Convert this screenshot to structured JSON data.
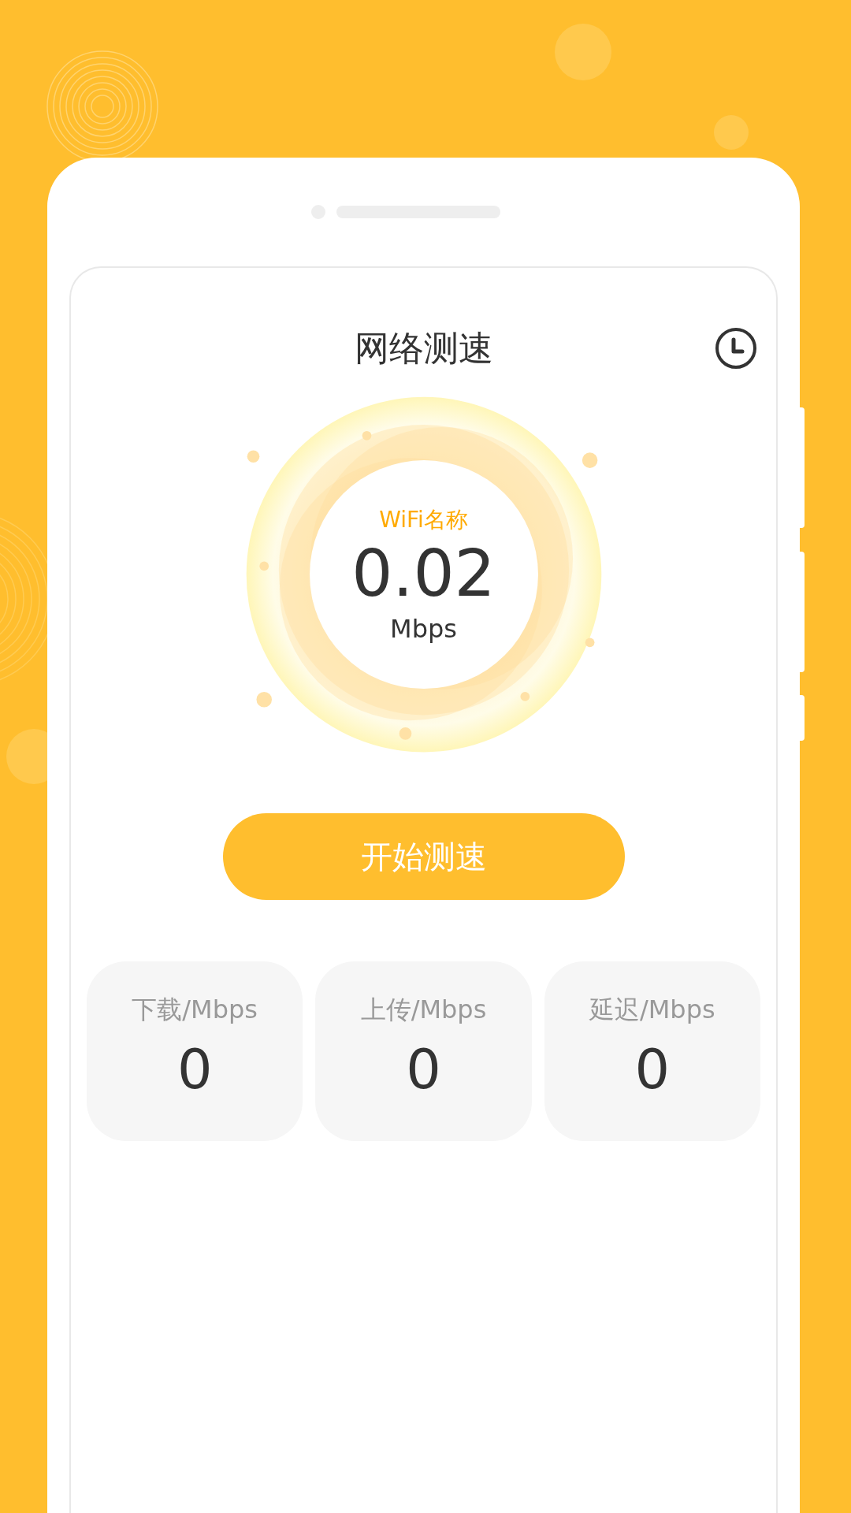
{
  "title": "网络测速",
  "gauge": {
    "network_name": "WiFi名称",
    "speed": "0.02",
    "unit": "Mbps"
  },
  "start_button": "开始测速",
  "stats": [
    {
      "label": "下载/Mbps",
      "value": "0"
    },
    {
      "label": "上传/Mbps",
      "value": "0"
    },
    {
      "label": "延迟/Mbps",
      "value": "0"
    }
  ]
}
